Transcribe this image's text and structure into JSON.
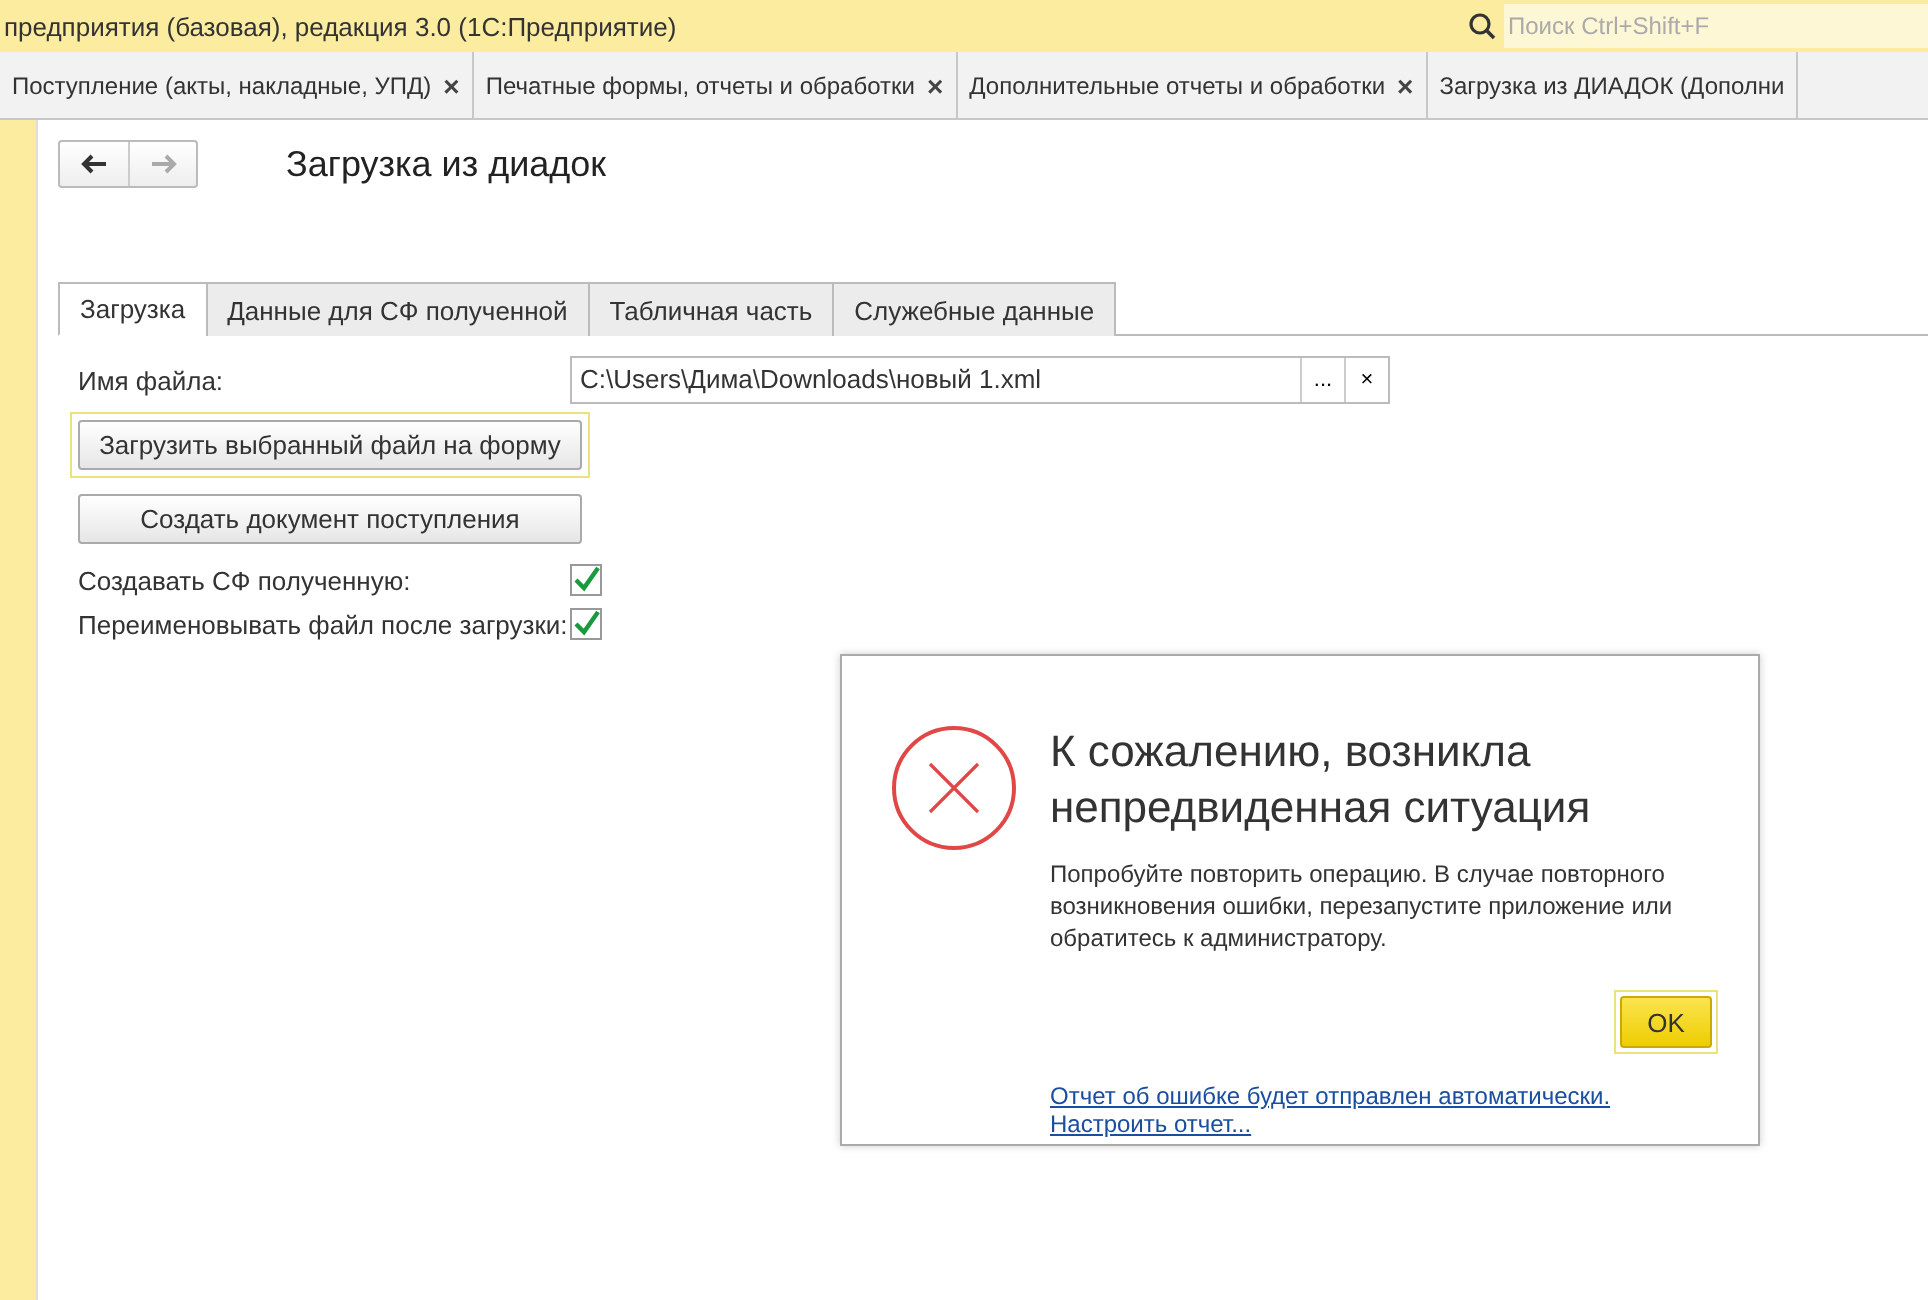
{
  "window": {
    "title": "предприятия (базовая), редакция 3.0  (1С:Предприятие)"
  },
  "search": {
    "placeholder": "Поиск Ctrl+Shift+F"
  },
  "open_tabs": [
    {
      "label": "Поступление (акты, накладные, УПД)",
      "close": "×"
    },
    {
      "label": "Печатные формы, отчеты и обработки",
      "close": "×"
    },
    {
      "label": "Дополнительные отчеты и обработки",
      "close": "×"
    },
    {
      "label": "Загрузка из ДИАДОК (Дополни"
    }
  ],
  "nav": {
    "back_disabled": false,
    "forward_disabled": true
  },
  "form": {
    "title": "Загрузка из диадок",
    "tabs": [
      {
        "label": "Загрузка",
        "selected": true
      },
      {
        "label": "Данные для СФ полученной",
        "selected": false
      },
      {
        "label": "Табличная часть",
        "selected": false
      },
      {
        "label": "Служебные данные",
        "selected": false
      }
    ],
    "file_field": {
      "label": "Имя файла:",
      "value": "C:\\Users\\Дима\\Downloads\\новый 1.xml",
      "select_button": "...",
      "clear_button": "×"
    },
    "buttons": [
      {
        "label": "Загрузить выбранный файл на форму",
        "focused": true
      },
      {
        "label": "Создать документ поступления",
        "focused": false
      }
    ],
    "checkboxes": [
      {
        "label": "Создавать СФ полученную:",
        "checked": true
      },
      {
        "label": "Переименовывать файл после загрузки:",
        "checked": true
      }
    ]
  },
  "error_dialog": {
    "title": "К сожалению, возникла непредвиденная ситуация",
    "message": "Попробуйте повторить операцию. В случае повторного возникновения ошибки, перезапустите приложение или обратитесь к администратору.",
    "ok_button": "OK",
    "links": [
      "Отчет об ошибке будет отправлен автоматически.",
      "Настроить отчет..."
    ]
  }
}
